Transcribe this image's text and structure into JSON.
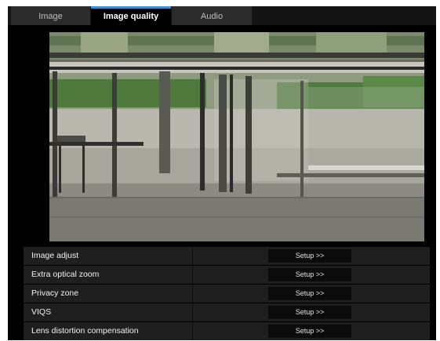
{
  "tabs": [
    {
      "label": "Image",
      "active": false
    },
    {
      "label": "Image quality",
      "active": true
    },
    {
      "label": "Audio",
      "active": false
    }
  ],
  "settings_rows": [
    {
      "label": "Image adjust",
      "button": "Setup >>"
    },
    {
      "label": "Extra optical zoom",
      "button": "Setup >>"
    },
    {
      "label": "Privacy zone",
      "button": "Setup >>"
    },
    {
      "label": "VIQS",
      "button": "Setup >>"
    },
    {
      "label": "Lens distortion compensation",
      "button": "Setup >>"
    }
  ],
  "colors": {
    "active_tab_accent": "#3b8fd3",
    "background": "#000000",
    "row_background": "#1f1f1f"
  }
}
